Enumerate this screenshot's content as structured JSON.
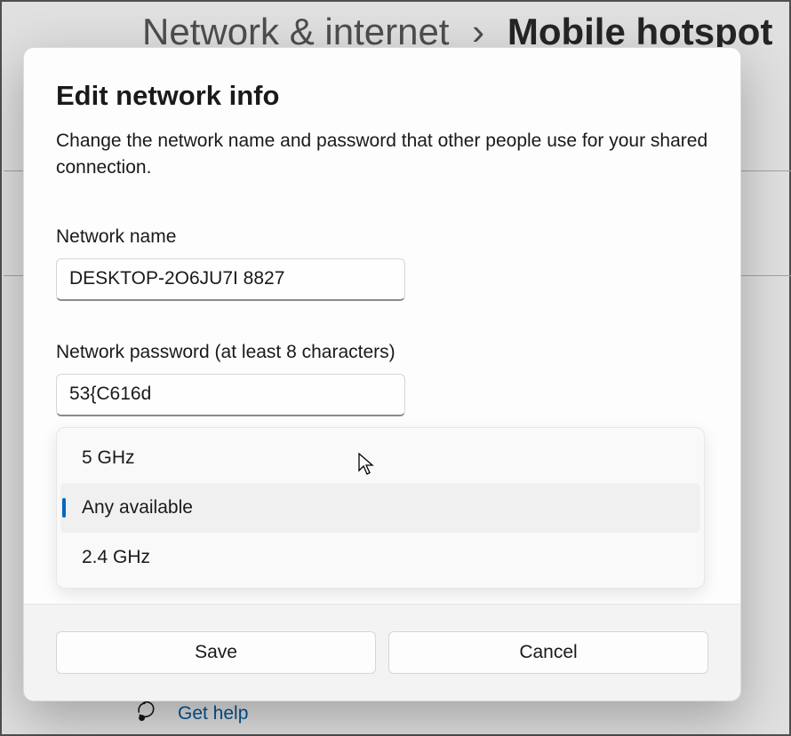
{
  "breadcrumb": {
    "parent": "Network & internet",
    "current": "Mobile hotspot"
  },
  "dialog": {
    "title": "Edit network info",
    "description": "Change the network name and password that other people use for your shared connection.",
    "network_name": {
      "label": "Network name",
      "value": "DESKTOP-2O6JU7I 8827"
    },
    "network_password": {
      "label": "Network password (at least 8 characters)",
      "value": "53{C616d"
    },
    "band_dropdown": {
      "options": [
        {
          "label": "5 GHz",
          "selected": false
        },
        {
          "label": "Any available",
          "selected": true
        },
        {
          "label": "2.4 GHz",
          "selected": false
        }
      ]
    },
    "buttons": {
      "save": "Save",
      "cancel": "Cancel"
    }
  },
  "help": {
    "label": "Get help"
  }
}
